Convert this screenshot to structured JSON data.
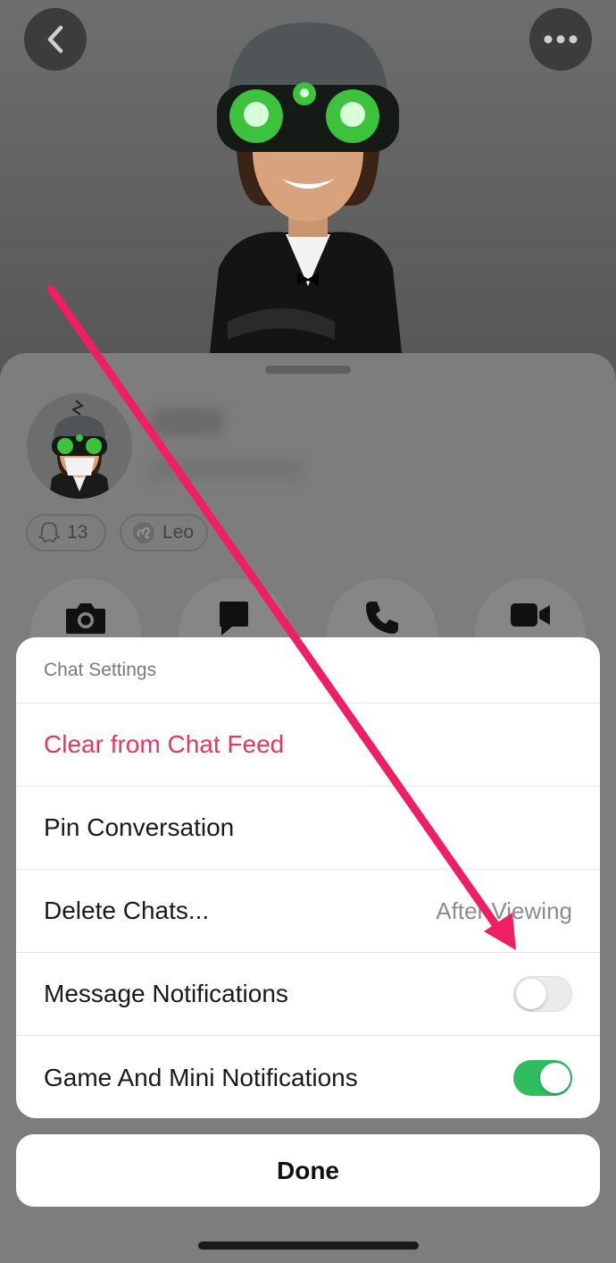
{
  "profile": {
    "snapscore": "13",
    "zodiac": "Leo"
  },
  "header": {
    "back_icon": "chevron-left-icon",
    "more_icon": "ellipsis-icon"
  },
  "actions": [
    {
      "icon": "camera-icon"
    },
    {
      "icon": "chat-icon"
    },
    {
      "icon": "phone-icon"
    },
    {
      "icon": "video-icon"
    }
  ],
  "chat_settings": {
    "title": "Chat Settings",
    "clear_label": "Clear from Chat Feed",
    "pin_label": "Pin Conversation",
    "delete_label": "Delete Chats...",
    "delete_value": "After Viewing",
    "message_notif_label": "Message Notifications",
    "message_notif_on": false,
    "game_notif_label": "Game And Mini Notifications",
    "game_notif_on": true
  },
  "done_label": "Done",
  "colors": {
    "destructive": "#e8375b",
    "toggle_on": "#2ebe5e",
    "annotation_arrow": "#f01e62"
  }
}
